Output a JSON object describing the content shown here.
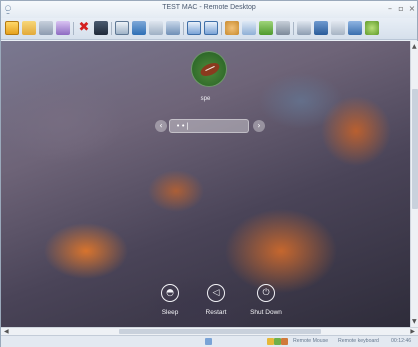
{
  "window": {
    "title": "TEST MAC - Remote Desktop"
  },
  "toolbar": {
    "buttons": [
      "connect-icon",
      "folder-icon",
      "tools-icon",
      "wand-icon",
      "disconnect-icon",
      "screen-icon",
      "fullscreen-icon",
      "monitor-icon",
      "keyboard-icon",
      "display-icon",
      "copy-icon",
      "paste-icon",
      "users-icon",
      "chat-icon",
      "signal-icon",
      "trash-icon",
      "window-icon",
      "group-icon",
      "settings-icon",
      "refresh-icon"
    ],
    "accent": "#2e6fb5"
  },
  "login": {
    "username": "spe",
    "password_value": "••|"
  },
  "power": {
    "sleep_label": "Sleep",
    "restart_label": "Restart",
    "shutdown_label": "Shut Down"
  },
  "statusbar": {
    "mouse": "Remote Mouse",
    "keyboard": "Remote keyboard",
    "time": "00:12:46"
  }
}
